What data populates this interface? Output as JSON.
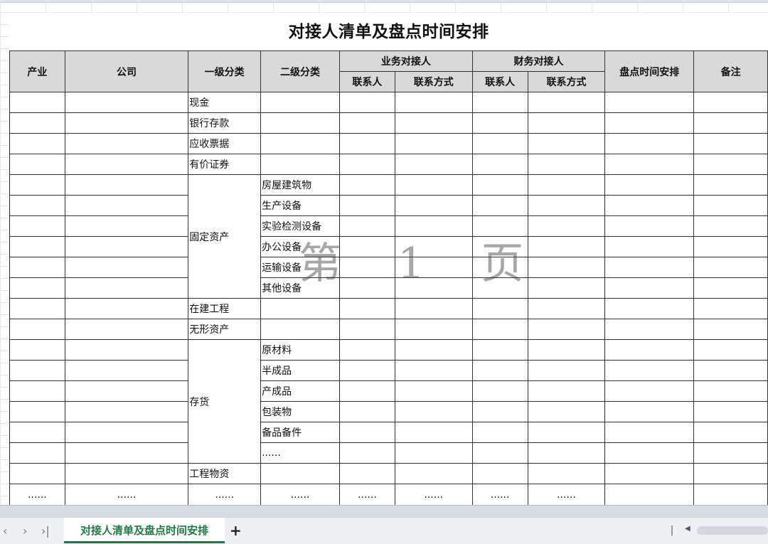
{
  "title": "对接人清单及盘点时间安排",
  "headers": {
    "industry": "产业",
    "company": "公司",
    "level1": "一级分类",
    "level2": "二级分类",
    "business_contact": "业务对接人",
    "finance_contact": "财务对接人",
    "contact_person": "联系人",
    "contact_method": "联系方式",
    "schedule": "盘点时间安排",
    "remarks": "备注"
  },
  "rows": [
    {
      "l1": "现金",
      "l2": ""
    },
    {
      "l1": "银行存款",
      "l2": ""
    },
    {
      "l1": "应收票据",
      "l2": ""
    },
    {
      "l1": "有价证券",
      "l2": ""
    },
    {
      "l1": "固定资产",
      "l2": "房屋建筑物"
    },
    {
      "l1": "",
      "l2": "生产设备"
    },
    {
      "l1": "",
      "l2": "实验检测设备"
    },
    {
      "l1": "",
      "l2": "办公设备"
    },
    {
      "l1": "",
      "l2": "运输设备"
    },
    {
      "l1": "",
      "l2": "其他设备"
    },
    {
      "l1": "在建工程",
      "l2": ""
    },
    {
      "l1": "无形资产",
      "l2": ""
    },
    {
      "l1": "存货",
      "l2": "原材料"
    },
    {
      "l1": "",
      "l2": "半成品"
    },
    {
      "l1": "",
      "l2": "产成品"
    },
    {
      "l1": "",
      "l2": "包装物"
    },
    {
      "l1": "",
      "l2": "备品备件"
    },
    {
      "l1": "",
      "l2": "......"
    },
    {
      "l1": "工程物资",
      "l2": ""
    }
  ],
  "ellipsis": "......",
  "watermark": "第 1 页",
  "sheet_tab": "对接人清单及盘点时间安排",
  "nav": {
    "prev": "‹",
    "next": "›",
    "last": "›|",
    "add": "+"
  },
  "colors": {
    "header_bg": "#d9d9d9",
    "tab_accent": "#1e7b45"
  }
}
